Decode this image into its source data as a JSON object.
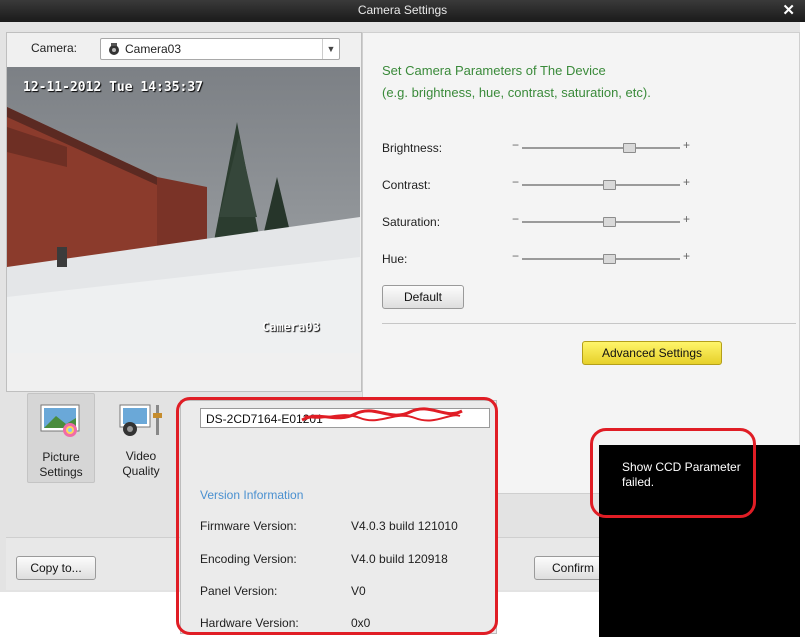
{
  "window": {
    "title": "Camera Settings",
    "close_glyph": "✕"
  },
  "camera": {
    "label": "Camera:",
    "selected": "Camera03"
  },
  "preview": {
    "timestamp": "12-11-2012 Tue 14:35:37",
    "osd_name": "Camera03"
  },
  "tabs": [
    {
      "label_line1": "Picture",
      "label_line2": "Settings",
      "icon": "picture-settings-icon",
      "active": true
    },
    {
      "label_line1": "Video",
      "label_line2": "Quality",
      "icon": "video-quality-icon",
      "active": false
    }
  ],
  "settings": {
    "header_line1": "Set Camera Parameters of The Device",
    "header_line2": "(e.g. brightness, hue, contrast, saturation, etc).",
    "sliders": [
      {
        "label": "Brightness:",
        "value": 0.68
      },
      {
        "label": "Contrast:",
        "value": 0.55
      },
      {
        "label": "Saturation:",
        "value": 0.55
      },
      {
        "label": "Hue:",
        "value": 0.55
      }
    ],
    "default_label": "Default",
    "advanced_label": "Advanced Settings",
    "minus": "−",
    "plus": "+"
  },
  "footer": {
    "copy_label": "Copy to...",
    "confirm_label": "Confirm"
  },
  "device": {
    "serial": "DS-2CD7164-E01201",
    "version_header": "Version Information",
    "versions": [
      {
        "label": "Firmware Version:",
        "value": "V4.0.3 build 121010"
      },
      {
        "label": "Encoding Version:",
        "value": "V4.0 build 120918"
      },
      {
        "label": "Panel Version:",
        "value": "V0"
      },
      {
        "label": "Hardware Version:",
        "value": "0x0"
      }
    ]
  },
  "toast": {
    "message": "Show CCD Parameter failed."
  },
  "colors": {
    "accent_green": "#3a8a3a",
    "link_blue": "#4a90d0",
    "annotation_red": "#e01d25",
    "advanced_yellow": "#f3e24a"
  }
}
